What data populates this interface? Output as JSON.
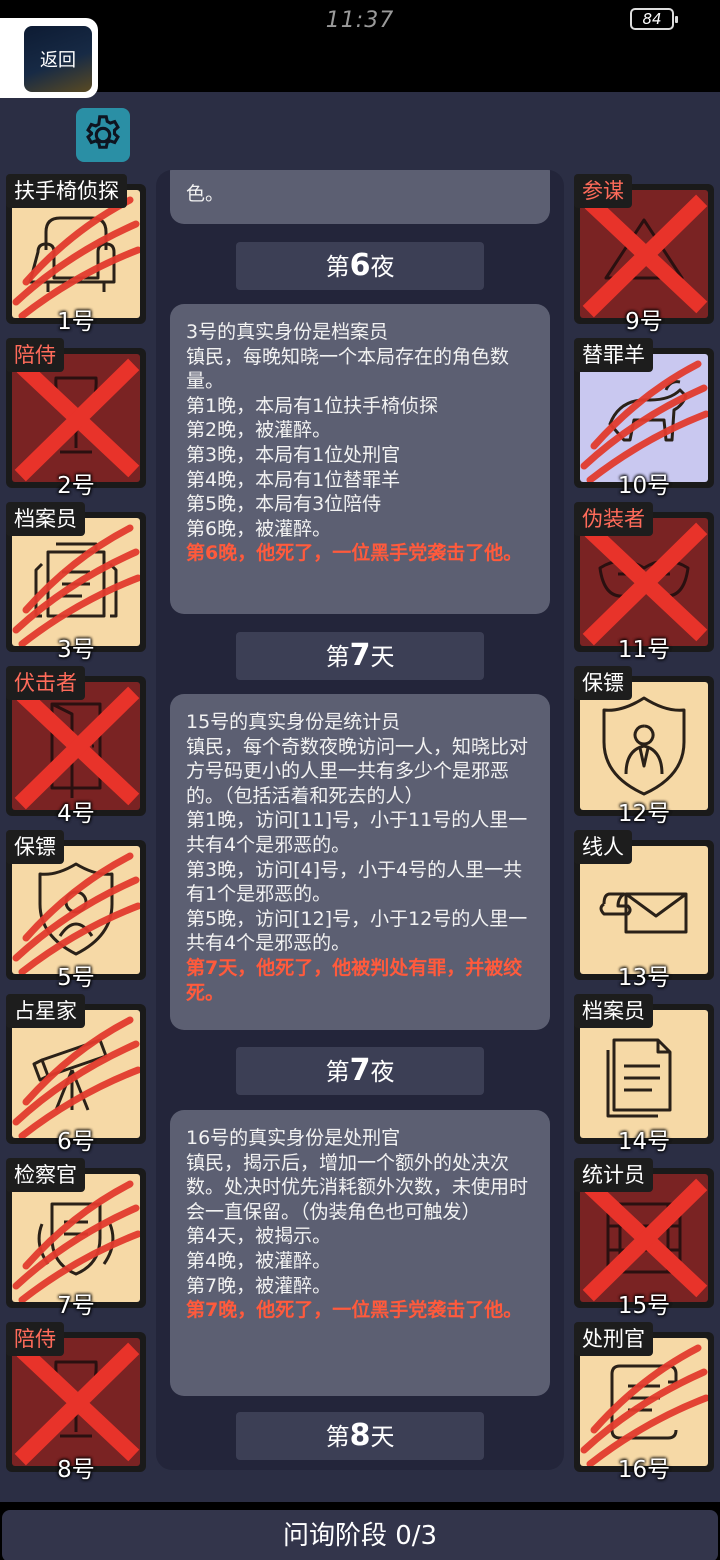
{
  "status_bar": {
    "time": "11:37",
    "battery": "84"
  },
  "back_button": {
    "label": "返回"
  },
  "players_left": [
    {
      "role": "扶手椅侦探",
      "number": "1号",
      "state": "slashed",
      "role_color": "white",
      "icon": "armchair-icon"
    },
    {
      "role": "陪侍",
      "number": "2号",
      "state": "executed",
      "role_color": "red",
      "icon": "wine-glass-icon"
    },
    {
      "role": "档案员",
      "number": "3号",
      "state": "slashed",
      "role_color": "white",
      "icon": "archive-icon"
    },
    {
      "role": "伏击者",
      "number": "4号",
      "state": "executed",
      "role_color": "red",
      "icon": "door-icon"
    },
    {
      "role": "保镖",
      "number": "5号",
      "state": "slashed",
      "role_color": "white",
      "icon": "shield-icon"
    },
    {
      "role": "占星家",
      "number": "6号",
      "state": "slashed",
      "role_color": "white",
      "icon": "telescope-icon"
    },
    {
      "role": "检察官",
      "number": "7号",
      "state": "slashed",
      "role_color": "white",
      "icon": "crest-icon"
    },
    {
      "role": "陪侍",
      "number": "8号",
      "state": "executed",
      "role_color": "red",
      "icon": "wine-glass-icon"
    }
  ],
  "players_right": [
    {
      "role": "参谋",
      "number": "9号",
      "state": "executed",
      "role_color": "red",
      "icon": "mask-icon"
    },
    {
      "role": "替罪羊",
      "number": "10号",
      "state": "slashed-scapegoat",
      "role_color": "white",
      "icon": "goat-icon"
    },
    {
      "role": "伪装者",
      "number": "11号",
      "state": "executed",
      "role_color": "red",
      "icon": "masquerade-icon"
    },
    {
      "role": "保镖",
      "number": "12号",
      "state": "alive",
      "role_color": "white",
      "icon": "bodyguard-icon"
    },
    {
      "role": "线人",
      "number": "13号",
      "state": "alive",
      "role_color": "white",
      "icon": "envelope-icon"
    },
    {
      "role": "档案员",
      "number": "14号",
      "state": "alive",
      "role_color": "white",
      "icon": "documents-icon"
    },
    {
      "role": "统计员",
      "number": "15号",
      "state": "executed",
      "role_color": "white",
      "icon": "abacus-icon"
    },
    {
      "role": "处刑官",
      "number": "16号",
      "state": "slashed",
      "role_color": "white",
      "icon": "scroll-icon"
    }
  ],
  "log": {
    "top_fragment": "色。",
    "entries": [
      {
        "header_prefix": "第",
        "header_num": "6",
        "header_suffix": "夜",
        "lines": [
          "3号的真实身份是档案员",
          "镇民，每晚知晓一个本局存在的角色数量。",
          "第1晚，本局有1位扶手椅侦探",
          "第2晚，被灌醉。",
          "第3晚，本局有1位处刑官",
          "第4晚，本局有1位替罪羊",
          "第5晚，本局有3位陪侍",
          "第6晚，被灌醉。"
        ],
        "death": "第6晚，他死了，一位黑手党袭击了他。"
      },
      {
        "header_prefix": "第",
        "header_num": "7",
        "header_suffix": "天",
        "lines": [
          "15号的真实身份是统计员",
          "镇民，每个奇数夜晚访问一人，知晓比对方号码更小的人里一共有多少个是邪恶的。（包括活着和死去的人）",
          "第1晚，访问[11]号，小于11号的人里一共有4个是邪恶的。",
          "第3晚，访问[4]号，小于4号的人里一共有1个是邪恶的。",
          "第5晚，访问[12]号，小于12号的人里一共有4个是邪恶的。"
        ],
        "death": "第7天，他死了，他被判处有罪，并被绞死。"
      },
      {
        "header_prefix": "第",
        "header_num": "7",
        "header_suffix": "夜",
        "lines": [
          "16号的真实身份是处刑官",
          "镇民，揭示后，增加一个额外的处决次数。处决时优先消耗额外次数，未使用时会一直保留。（伪装角色也可触发）",
          "第4天，被揭示。",
          "第4晚，被灌醉。",
          "第7晚，被灌醉。"
        ],
        "death": "第7晚，他死了，一位黑手党袭击了他。"
      }
    ],
    "last_header": {
      "prefix": "第",
      "num": "8",
      "suffix": "天"
    }
  },
  "footer": {
    "phase_label": "问询阶段 0/3"
  },
  "colors": {
    "background": "#2b2e44",
    "card": "#5c5f72",
    "death_text": "#ff5a3c",
    "alive_tile": "#f6d9a6",
    "dead_tile": "#7a2323",
    "settings": "#2a8fa5"
  }
}
